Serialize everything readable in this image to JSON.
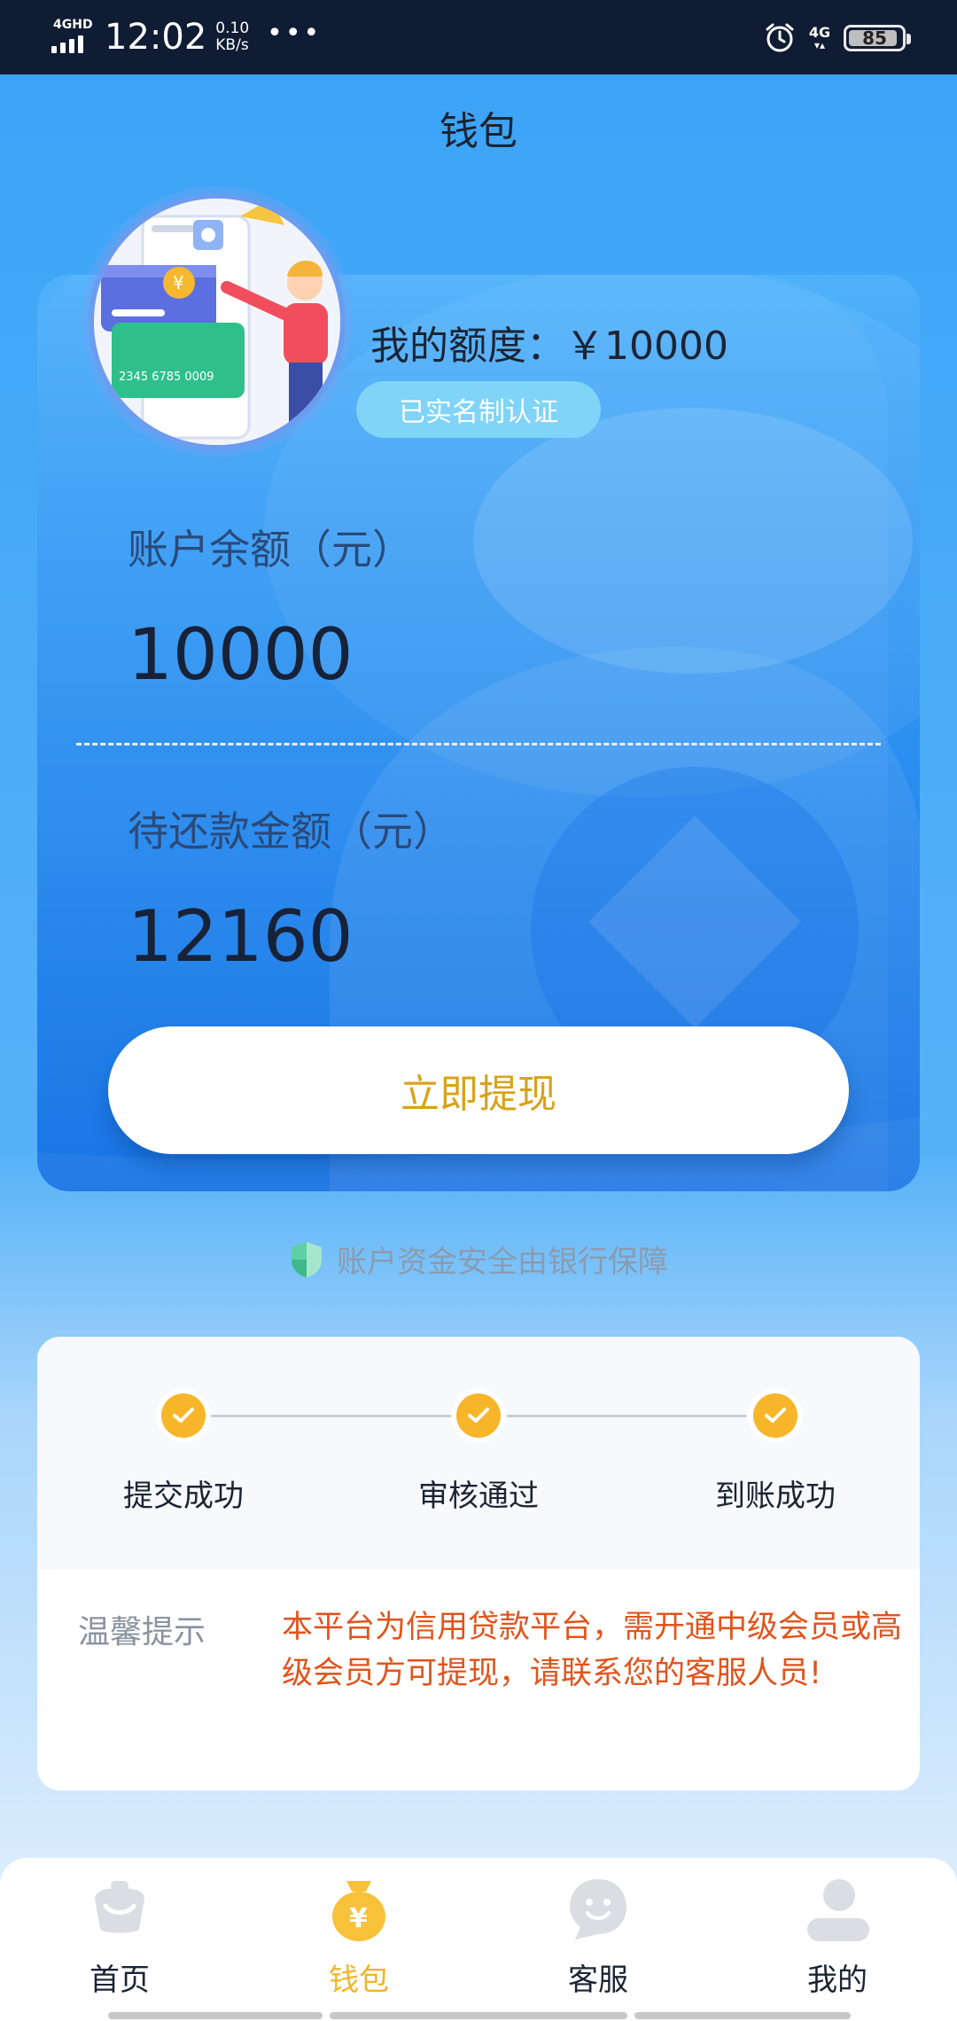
{
  "status_bar": {
    "signal_label": "4GHD",
    "time": "12:02",
    "net_speed_value": "0.10",
    "net_speed_unit": "KB/s",
    "more_indicator": "•••",
    "network": "4G",
    "battery": "85",
    "icons": [
      "signal-icon",
      "alarm-icon",
      "network-4g-icon",
      "battery-icon"
    ]
  },
  "header": {
    "title": "钱包"
  },
  "wallet": {
    "quota_label": "我的额度：",
    "quota_value": "￥10000",
    "verified_badge": "已实名制认证",
    "balance_label": "账户余额（元）",
    "balance_value": "10000",
    "due_label": "待还款金额（元）",
    "due_value": "12160",
    "withdraw_button": "立即提现"
  },
  "security_note": "账户资金安全由银行保障",
  "progress": {
    "steps": [
      {
        "label": "提交成功"
      },
      {
        "label": "审核通过"
      },
      {
        "label": "到账成功"
      }
    ]
  },
  "tip": {
    "title": "温馨提示",
    "body": "本平台为信用贷款平台，需开通中级会员或高级会员方可提现，请联系您的客服人员!"
  },
  "bottom_nav": {
    "items": [
      {
        "label": "首页",
        "icon": "home-icon"
      },
      {
        "label": "钱包",
        "icon": "wallet-icon"
      },
      {
        "label": "客服",
        "icon": "customer-service-icon"
      },
      {
        "label": "我的",
        "icon": "profile-icon"
      }
    ],
    "active_index": 1
  },
  "colors": {
    "accent": "#f2b42a",
    "card_blue": "#2f93f2",
    "tip_text": "#e0541c",
    "status_bar": "#0f1c33"
  }
}
